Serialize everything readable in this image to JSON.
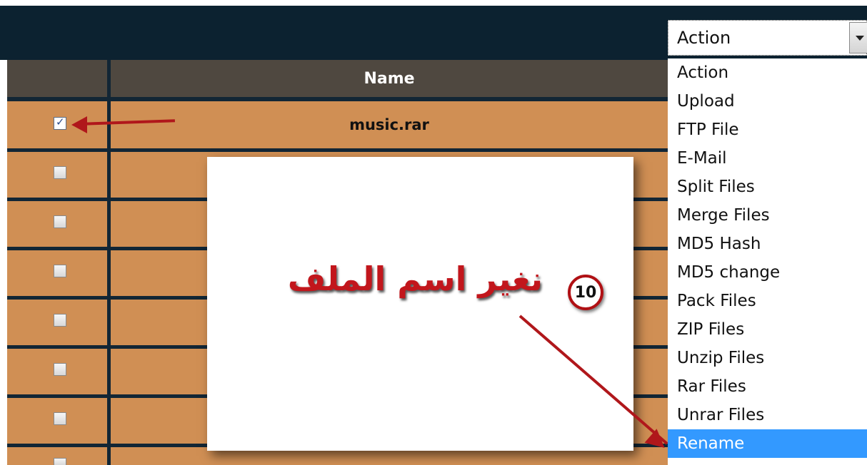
{
  "table": {
    "header": {
      "name_label": "Name"
    },
    "rows": [
      {
        "checked": true,
        "name": "music.rar"
      },
      {
        "checked": false,
        "name": ""
      },
      {
        "checked": false,
        "name": ""
      },
      {
        "checked": false,
        "name": ""
      },
      {
        "checked": false,
        "name": ""
      },
      {
        "checked": false,
        "name": ""
      },
      {
        "checked": false,
        "name": ""
      },
      {
        "checked": false,
        "name": ""
      }
    ]
  },
  "action_select": {
    "value": "Action",
    "options": [
      "Action",
      "Upload",
      "FTP File",
      "E-Mail",
      "Split Files",
      "Merge Files",
      "MD5 Hash",
      "MD5 change",
      "Pack Files",
      "ZIP Files",
      "Unzip Files",
      "Rar Files",
      "Unrar Files",
      "Rename"
    ],
    "highlighted": "Rename"
  },
  "annotation": {
    "step_number": "10",
    "text": "نغير اسم الملف"
  },
  "colors": {
    "header_bar": "#0c2230",
    "grid_line": "#122635",
    "column_header": "#4f4840",
    "row": "#d08f54",
    "selection": "#3399ff",
    "annotation_red": "#c2161c"
  }
}
